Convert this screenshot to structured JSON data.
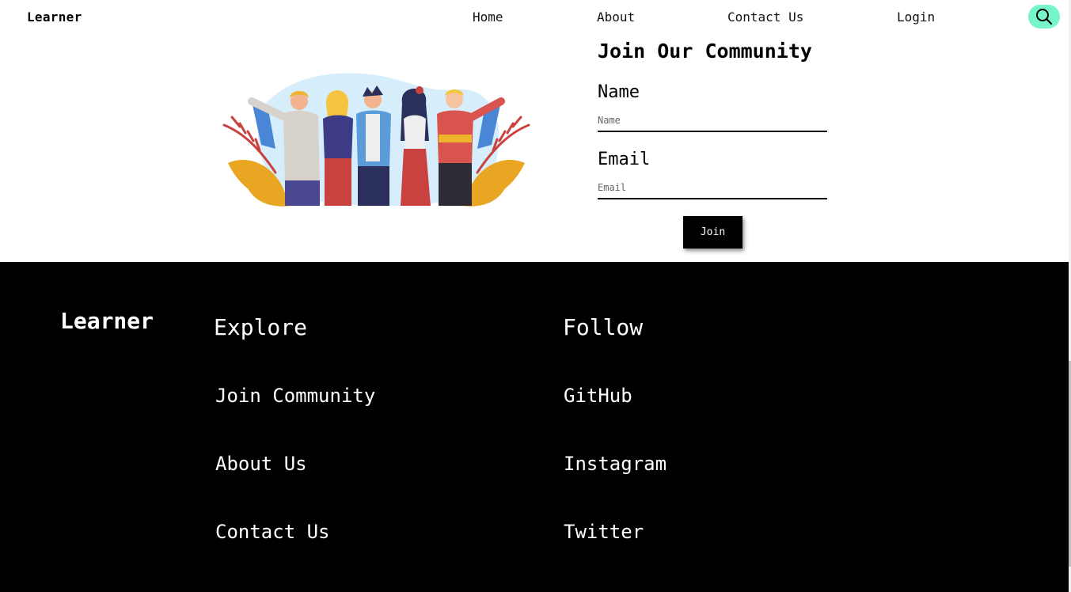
{
  "nav": {
    "brand": "Learner",
    "links": [
      "Home",
      "About",
      "Contact Us",
      "Login"
    ],
    "search_icon": "search-icon",
    "search_bg": "#76f5c9"
  },
  "hero": {
    "illustration": "community-people-illustration"
  },
  "form": {
    "title": "Join Our Community",
    "name_label": "Name",
    "name_placeholder": "Name",
    "email_label": "Email",
    "email_placeholder": "Email",
    "submit_label": "Join"
  },
  "footer": {
    "brand": "Learner",
    "explore": {
      "heading": "Explore",
      "links": [
        "Join Community",
        "About Us",
        "Contact Us"
      ]
    },
    "follow": {
      "heading": "Follow",
      "links": [
        "GitHub",
        "Instagram",
        "Twitter"
      ]
    },
    "background": "#000000"
  }
}
